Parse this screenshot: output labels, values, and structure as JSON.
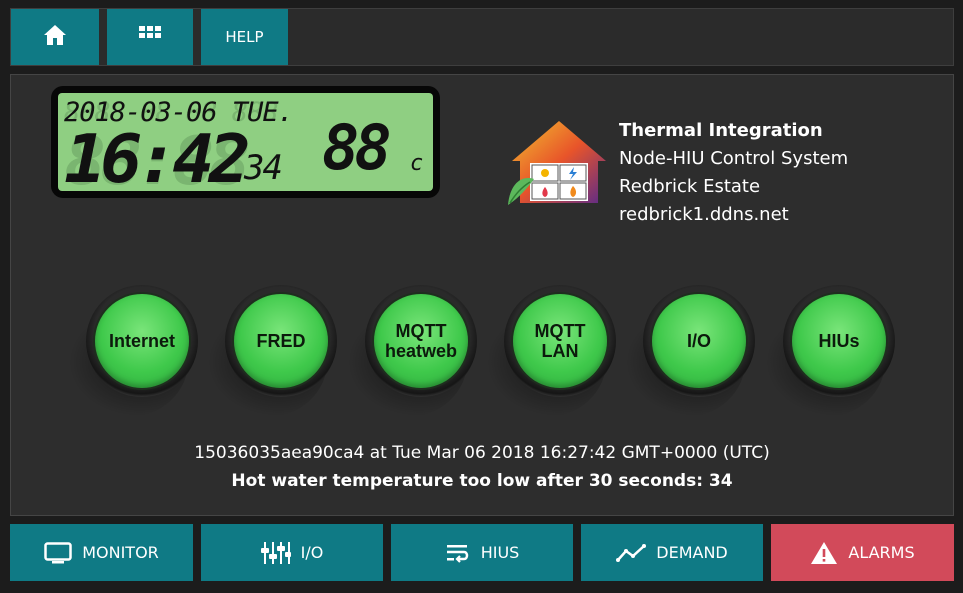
{
  "topnav": {
    "home_icon": "home-icon",
    "apps_icon": "grid-icon",
    "help_label": "HELP"
  },
  "lcd": {
    "date": "2018-03-06",
    "day": "TUE.",
    "time": "16:42",
    "seconds": "34",
    "temperature": "88",
    "unit": "c",
    "ghost_date": "8888-88-88 888.",
    "ghost_time": "88:88"
  },
  "info": {
    "title": "Thermal Integration",
    "subtitle": "Node-HIU Control System",
    "site": "Redbrick Estate",
    "host": "redbrick1.ddns.net"
  },
  "status_buttons": [
    {
      "label": "Internet"
    },
    {
      "label": "FRED"
    },
    {
      "label": "MQTT\nheatweb"
    },
    {
      "label": "MQTT\nLAN"
    },
    {
      "label": "I/O"
    },
    {
      "label": "HIUs"
    }
  ],
  "status": {
    "line1": "15036035aea90ca4 at Tue Mar 06 2018 16:27:42 GMT+0000 (UTC)",
    "line2": "Hot water temperature too low after 30 seconds: 34"
  },
  "bottomnav": [
    {
      "label": "MONITOR",
      "icon": "monitor-icon"
    },
    {
      "label": "I/O",
      "icon": "sliders-icon"
    },
    {
      "label": "HIUS",
      "icon": "wrap-lines-icon"
    },
    {
      "label": "DEMAND",
      "icon": "trend-line-icon"
    },
    {
      "label": "ALARMS",
      "icon": "warning-icon"
    }
  ],
  "colors": {
    "accent": "#0f7a85",
    "alarm": "#d24a5a",
    "panel": "#2d2d2d",
    "lcd": "#8fcf82",
    "button_green": "#3fc94b"
  }
}
